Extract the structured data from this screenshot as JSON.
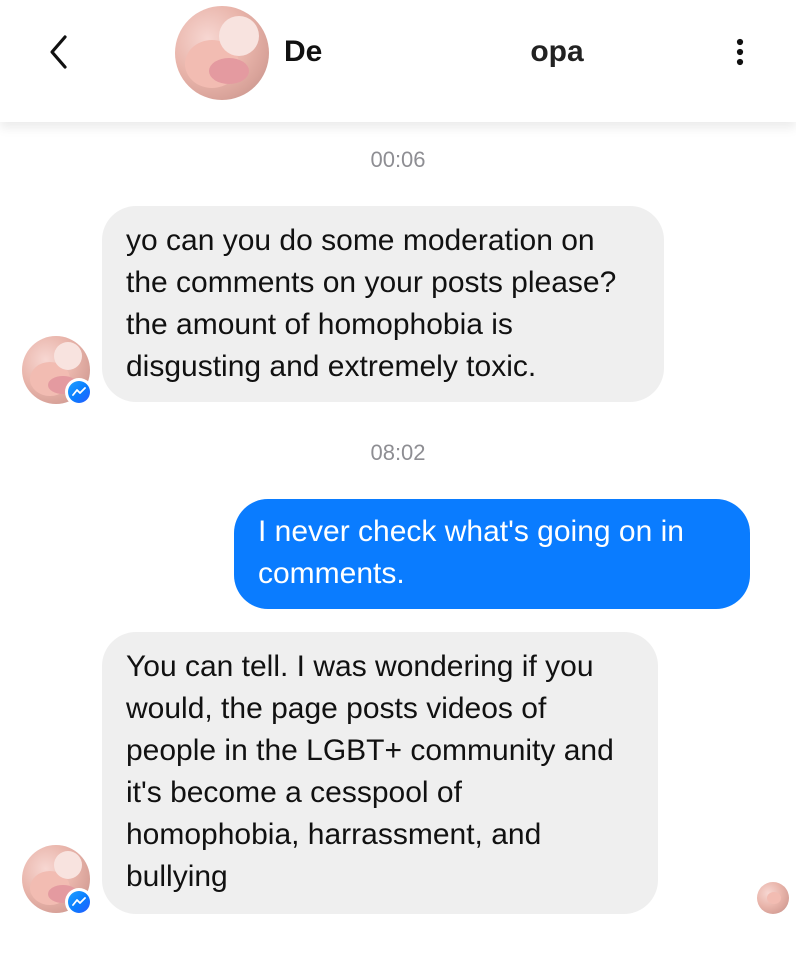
{
  "header": {
    "contact_name_visible_start": "De",
    "contact_name_visible_end": "opa",
    "back_icon": "chevron-left-icon",
    "menu_icon": "more-vertical-icon"
  },
  "thread": {
    "timestamps": [
      "00:06",
      "08:02"
    ],
    "messages": [
      {
        "direction": "incoming",
        "text": "yo can you do some moderation on the comments on your posts please? the amount of homophobia is disgusting and extremely toxic."
      },
      {
        "direction": "outgoing",
        "text": "I never check what's going on in comments."
      },
      {
        "direction": "incoming",
        "text": "You can tell. I was wondering if you would, the page posts videos of people in the LGBT+ community and it's become a cesspool of homophobia, harrassment, and bullying"
      }
    ]
  },
  "colors": {
    "incoming_bubble": "#efefef",
    "outgoing_bubble": "#0a7cff",
    "timestamp": "#8e8e93",
    "messenger_badge": "#0a7cff"
  },
  "icons": {
    "badge": "messenger-badge-icon",
    "seen": "seen-avatar-icon"
  }
}
